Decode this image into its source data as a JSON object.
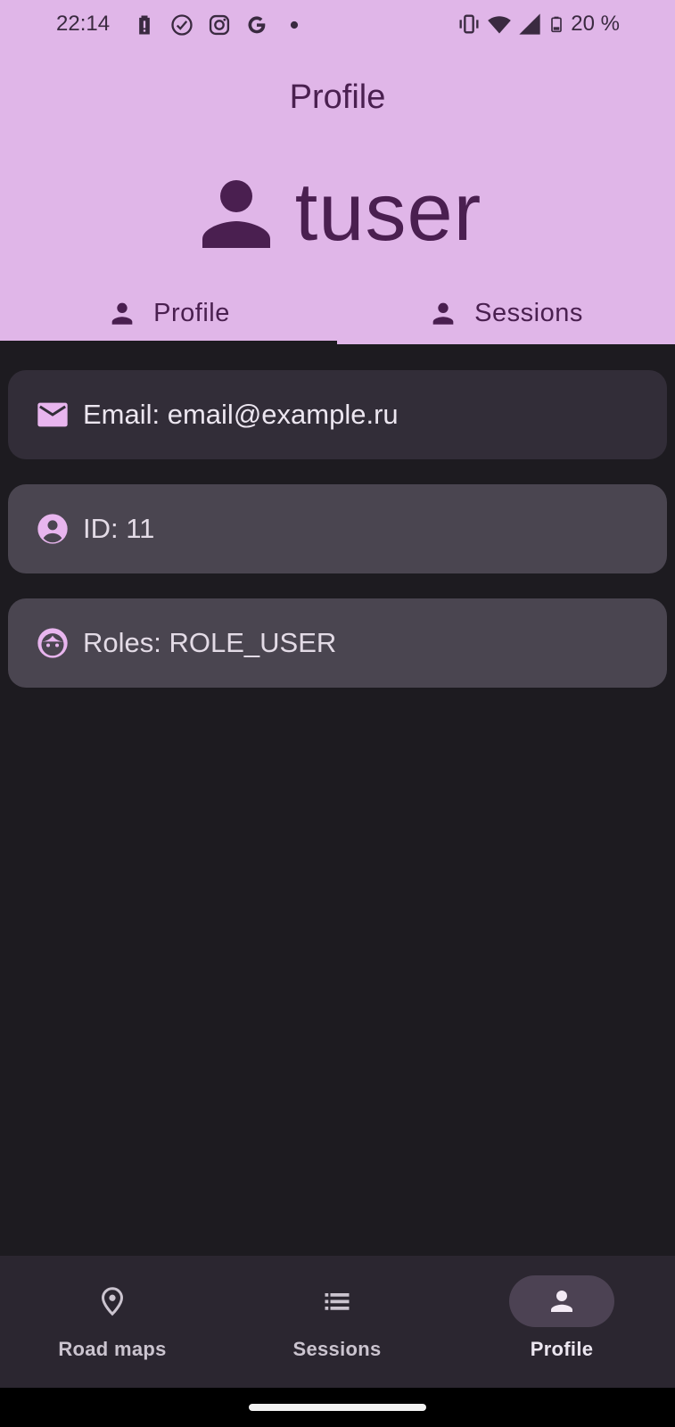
{
  "status_bar": {
    "time": "22:14",
    "battery_percent": "20 %",
    "left_icons": [
      "battery-alert-icon",
      "check-circle-icon",
      "instagram-icon",
      "google-icon",
      "dot-icon"
    ],
    "right_icons": [
      "vibrate-icon",
      "wifi-icon",
      "signal-icon",
      "battery-icon"
    ]
  },
  "header": {
    "title": "Profile",
    "username": "tuser",
    "user_icon": "person-icon"
  },
  "tabs": [
    {
      "label": "Profile",
      "icon": "person-icon",
      "active": true
    },
    {
      "label": "Sessions",
      "icon": "person-icon",
      "active": false
    }
  ],
  "cards": {
    "email": {
      "text": "Email: email@example.ru",
      "icon": "mail-icon"
    },
    "id": {
      "text": "ID: 11",
      "icon": "account-circle-icon"
    },
    "roles": {
      "text": "Roles: ROLE_USER",
      "icon": "face-icon"
    }
  },
  "bottom_nav": [
    {
      "label": "Road maps",
      "icon": "location-pin-icon",
      "active": false
    },
    {
      "label": "Sessions",
      "icon": "list-icon",
      "active": false
    },
    {
      "label": "Profile",
      "icon": "person-icon",
      "active": true
    }
  ],
  "colors": {
    "header_bg": "#e0b6e8",
    "header_text": "#4a2050",
    "screen_bg": "#1d1b20",
    "card_email_bg": "#322d38",
    "card_bg": "#4a4550",
    "accent_icon": "#e8b5ee",
    "nav_bg": "#2b2630",
    "nav_active_pill": "#4c4253"
  }
}
